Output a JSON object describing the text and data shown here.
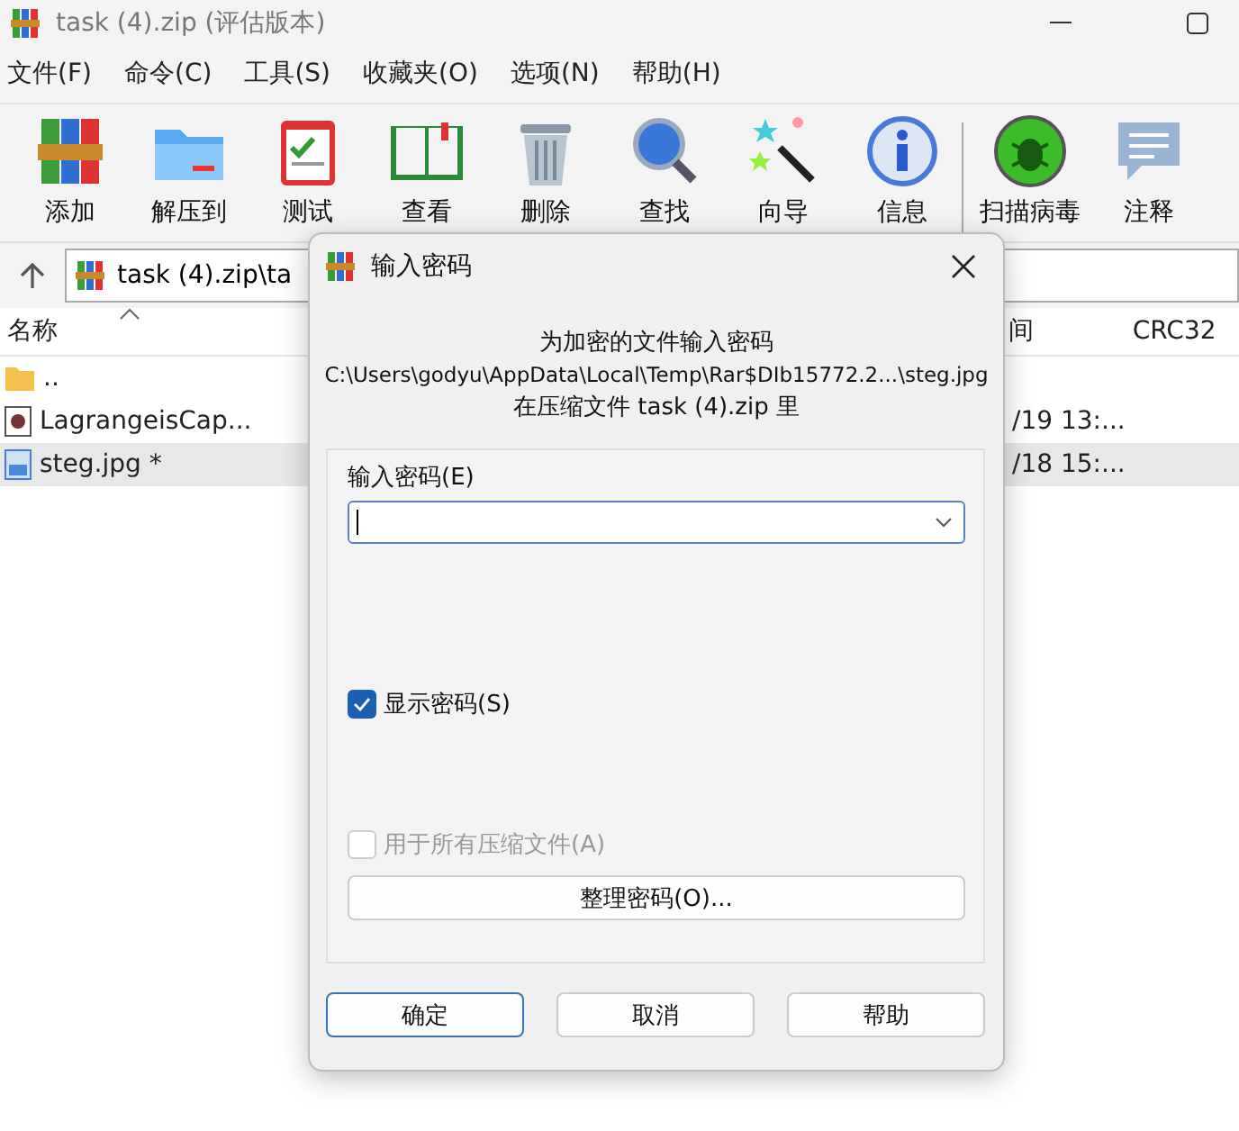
{
  "window": {
    "title": "task (4).zip (评估版本)"
  },
  "menu": [
    "文件(F)",
    "命令(C)",
    "工具(S)",
    "收藏夹(O)",
    "选项(N)",
    "帮助(H)"
  ],
  "toolbar": [
    {
      "kind": "add",
      "label": "添加"
    },
    {
      "kind": "extract",
      "label": "解压到"
    },
    {
      "kind": "test",
      "label": "测试"
    },
    {
      "kind": "view",
      "label": "查看"
    },
    {
      "kind": "delete",
      "label": "删除"
    },
    {
      "kind": "find",
      "label": "查找"
    },
    {
      "kind": "wizard",
      "label": "向导"
    },
    {
      "kind": "info",
      "label": "信息"
    },
    {
      "kind": "virus",
      "label": "扫描病毒",
      "separator_before": true
    },
    {
      "kind": "comment",
      "label": "注释"
    }
  ],
  "address": {
    "path": "task (4).zip\\ta"
  },
  "columns": [
    {
      "label": "名称",
      "sorted": true
    },
    {
      "label": "间"
    },
    {
      "label": "CRC32"
    }
  ],
  "rows": [
    {
      "kind": "folder",
      "name": "..",
      "selected": false
    },
    {
      "kind": "media",
      "name": "LagrangeisCap...",
      "modified": "/19 13:...",
      "selected": false
    },
    {
      "kind": "image",
      "name": "steg.jpg *",
      "modified": "/18 15:...",
      "selected": true
    }
  ],
  "dialog": {
    "title": "输入密码",
    "lines": [
      "为加密的文件输入密码",
      "C:\\Users\\godyu\\AppData\\Local\\Temp\\Rar$DIb15772.2...\\steg.jpg",
      "在压缩文件 task (4).zip 里"
    ],
    "password_label": "输入密码(E)",
    "options": [
      {
        "label": "显示密码(S)",
        "checked": true,
        "disabled": false
      },
      {
        "label": "用于所有压缩文件(A)",
        "checked": false,
        "disabled": true
      }
    ],
    "organize_button": "整理密码(O)...",
    "buttons": [
      {
        "label": "确定",
        "default": true
      },
      {
        "label": "取消",
        "default": false
      },
      {
        "label": "帮助",
        "default": false
      }
    ]
  }
}
